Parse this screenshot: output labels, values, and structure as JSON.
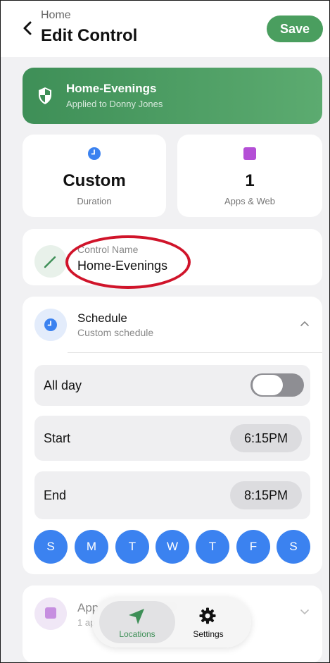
{
  "header": {
    "breadcrumb": "Home",
    "title": "Edit Control",
    "save_label": "Save"
  },
  "banner": {
    "title": "Home-Evenings",
    "subtitle": "Applied to Donny Jones",
    "icon": "shield-icon"
  },
  "stats": [
    {
      "value": "Custom",
      "label": "Duration",
      "icon": "clock-icon",
      "color": "#3b82f0"
    },
    {
      "value": "1",
      "label": "Apps & Web",
      "icon": "app-square-icon",
      "color": "#b44fd6"
    }
  ],
  "control_name": {
    "label": "Control Name",
    "value": "Home-Evenings"
  },
  "schedule": {
    "title": "Schedule",
    "subtitle": "Custom schedule",
    "all_day_label": "All day",
    "all_day_on": false,
    "start_label": "Start",
    "start_time": "6:15PM",
    "end_label": "End",
    "end_time": "8:15PM",
    "days": [
      "S",
      "M",
      "T",
      "W",
      "T",
      "F",
      "S"
    ]
  },
  "apps_section": {
    "title": "App",
    "subtitle": "1 ap"
  },
  "tabbar": {
    "tabs": [
      {
        "label": "Locations",
        "icon": "location-arrow-icon",
        "active": true
      },
      {
        "label": "Settings",
        "icon": "gear-icon",
        "active": false
      }
    ]
  },
  "colors": {
    "accent_green": "#4a9e5f",
    "accent_blue": "#3b82f0",
    "annotation_red": "#d0142a"
  }
}
